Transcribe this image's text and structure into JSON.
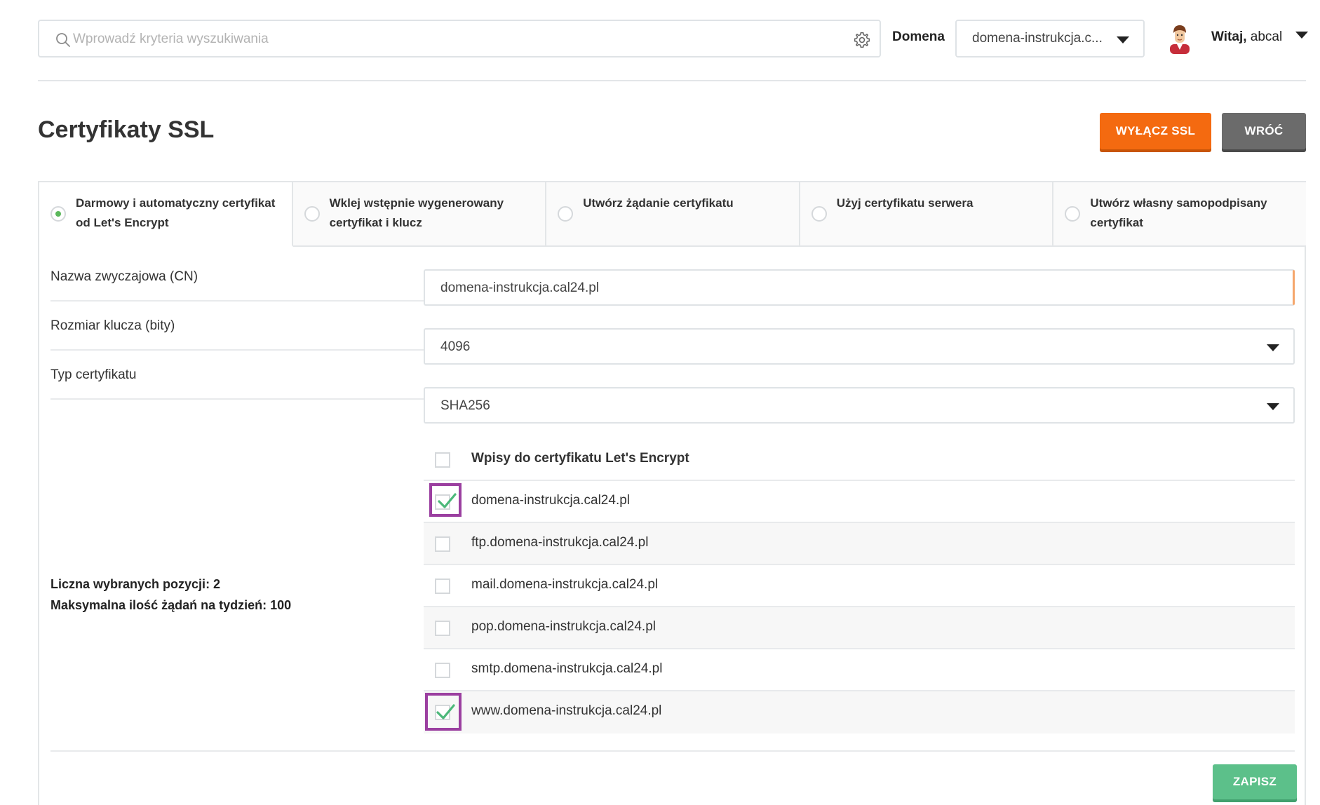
{
  "search": {
    "placeholder": "Wprowadź kryteria wyszukiwania"
  },
  "header": {
    "domain_label": "Domena",
    "domain_value": "domena-instrukcja.c...",
    "greeting_prefix": "Witaj,",
    "username": "abcal"
  },
  "page": {
    "title": "Certyfikaty SSL",
    "disable_ssl_label": "WYŁĄCZ SSL",
    "back_label": "WRÓĆ",
    "save_label": "ZAPISZ"
  },
  "tabs": [
    {
      "label": "Darmowy i automatyczny certyfikat od Let's Encrypt",
      "selected": true
    },
    {
      "label": "Wklej wstępnie wygenerowany certyfikat i klucz",
      "selected": false
    },
    {
      "label": "Utwórz żądanie certyfikatu",
      "selected": false
    },
    {
      "label": "Użyj certyfikatu serwera",
      "selected": false
    },
    {
      "label": "Utwórz własny samopodpisany certyfikat",
      "selected": false
    }
  ],
  "form": {
    "cn_label": "Nazwa zwyczajowa (CN)",
    "cn_value": "domena-instrukcja.cal24.pl",
    "key_size_label": "Rozmiar klucza (bity)",
    "key_size_value": "4096",
    "cert_type_label": "Typ certyfikatu",
    "cert_type_value": "SHA256"
  },
  "entries": {
    "header_label": "Wpisy do certyfikatu Let's Encrypt",
    "items": [
      {
        "label": "domena-instrukcja.cal24.pl",
        "checked": true
      },
      {
        "label": "ftp.domena-instrukcja.cal24.pl",
        "checked": false
      },
      {
        "label": "mail.domena-instrukcja.cal24.pl",
        "checked": false
      },
      {
        "label": "pop.domena-instrukcja.cal24.pl",
        "checked": false
      },
      {
        "label": "smtp.domena-instrukcja.cal24.pl",
        "checked": false
      },
      {
        "label": "www.domena-instrukcja.cal24.pl",
        "checked": true
      }
    ],
    "selected_count_text": "Liczna wybranych pozycji: 2",
    "weekly_limit_text": "Maksymalna ilość żądań na tydzień: 100"
  },
  "colors": {
    "accent_orange": "#f46a10",
    "back_gray": "#6b6b6b",
    "save_green": "#5cc08a",
    "highlight_purple": "#9b3fa0",
    "radio_green": "#5cb85c"
  },
  "icons": [
    "search-icon",
    "gear-icon",
    "chevron-down-icon",
    "avatar",
    "check-icon"
  ]
}
